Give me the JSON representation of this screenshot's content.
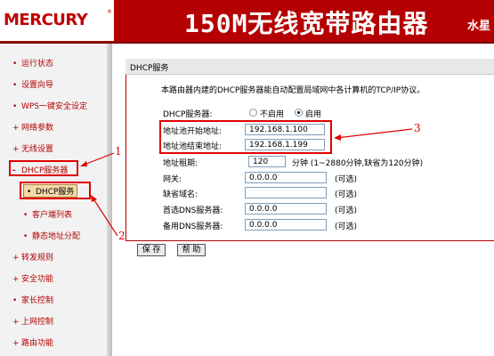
{
  "header": {
    "logo": "MERCURY",
    "logo_tm": "®",
    "title": "150M无线宽带路由器",
    "model": "水星"
  },
  "sidebar": {
    "items": [
      {
        "label": "运行状态",
        "prefix": "•"
      },
      {
        "label": "设置向导",
        "prefix": "•"
      },
      {
        "label": "WPS一键安全设定",
        "prefix": "•"
      },
      {
        "label": "网络参数",
        "prefix": "+"
      },
      {
        "label": "无线设置",
        "prefix": "+"
      },
      {
        "label": "DHCP服务器",
        "prefix": "-"
      },
      {
        "label": "DHCP服务",
        "prefix": "•"
      },
      {
        "label": "客户端列表",
        "prefix": "•"
      },
      {
        "label": "静态地址分配",
        "prefix": "•"
      },
      {
        "label": "转发规则",
        "prefix": "+"
      },
      {
        "label": "安全功能",
        "prefix": "+"
      },
      {
        "label": "家长控制",
        "prefix": "•"
      },
      {
        "label": "上网控制",
        "prefix": "+"
      },
      {
        "label": "路由功能",
        "prefix": "+"
      }
    ]
  },
  "panel": {
    "title": "DHCP服务",
    "description": "本路由器内建的DHCP服务器能自动配置局域网中各计算机的TCP/IP协议。",
    "dhcp_label": "DHCP服务器:",
    "radio_off": "不启用",
    "radio_on": "启用",
    "start_label": "地址池开始地址:",
    "start_value": "192.168.1.100",
    "end_label": "地址池结束地址:",
    "end_value": "192.168.1.199",
    "lease_label": "地址租期:",
    "lease_value": "120",
    "lease_unit": "分钟 (1~2880分钟,缺省为120分钟)",
    "gateway_label": "网关:",
    "gateway_value": "0.0.0.0",
    "domain_label": "缺省域名:",
    "domain_value": "",
    "dns1_label": "首选DNS服务器:",
    "dns1_value": "0.0.0.0",
    "dns2_label": "备用DNS服务器:",
    "dns2_value": "0.0.0.0",
    "optional": "(可选)",
    "save": "保 存",
    "help": "帮 助"
  },
  "annotations": {
    "n1": "1",
    "n2": "2",
    "n3": "3"
  },
  "colors": {
    "brand": "#b40000",
    "annotation": "#e00000"
  }
}
